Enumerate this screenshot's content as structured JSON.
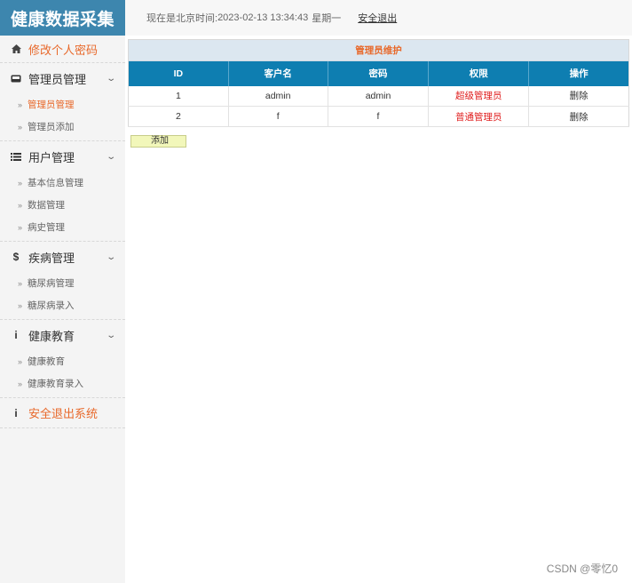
{
  "app": {
    "title": "健康数据采集"
  },
  "header": {
    "time_prefix": "现在是北京时间: ",
    "datetime": "2023-02-13 13:34:43",
    "weekday": "星期一",
    "logout_label": "安全退出"
  },
  "sidebar": {
    "change_password": "修改个人密码",
    "groups": [
      {
        "label": "管理员管理",
        "icon": "inbox-icon",
        "items": [
          "管理员管理",
          "管理员添加"
        ]
      },
      {
        "label": "用户管理",
        "icon": "list-icon",
        "items": [
          "基本信息管理",
          "数据管理",
          "病史管理"
        ]
      },
      {
        "label": "疾病管理",
        "icon": "dollar-icon",
        "items": [
          "糖尿病管理",
          "糖尿病录入"
        ]
      },
      {
        "label": "健康教育",
        "icon": "info-icon",
        "items": [
          "健康教育",
          "健康教育录入"
        ]
      }
    ],
    "exit_label": "安全退出系统"
  },
  "table": {
    "caption": "管理员维护",
    "columns": [
      "ID",
      "客户名",
      "密码",
      "权限",
      "操作"
    ],
    "rows": [
      [
        "1",
        "admin",
        "admin",
        "超级管理员",
        "删除"
      ],
      [
        "2",
        "f",
        "f",
        "普通管理员",
        "删除"
      ]
    ]
  },
  "add_button": "添加",
  "watermark": "CSDN @零忆0",
  "colors": {
    "accent": "#e8692b",
    "header_blue": "#0e7eb1",
    "logo_bg": "#3d86ae",
    "danger": "#e02020"
  }
}
